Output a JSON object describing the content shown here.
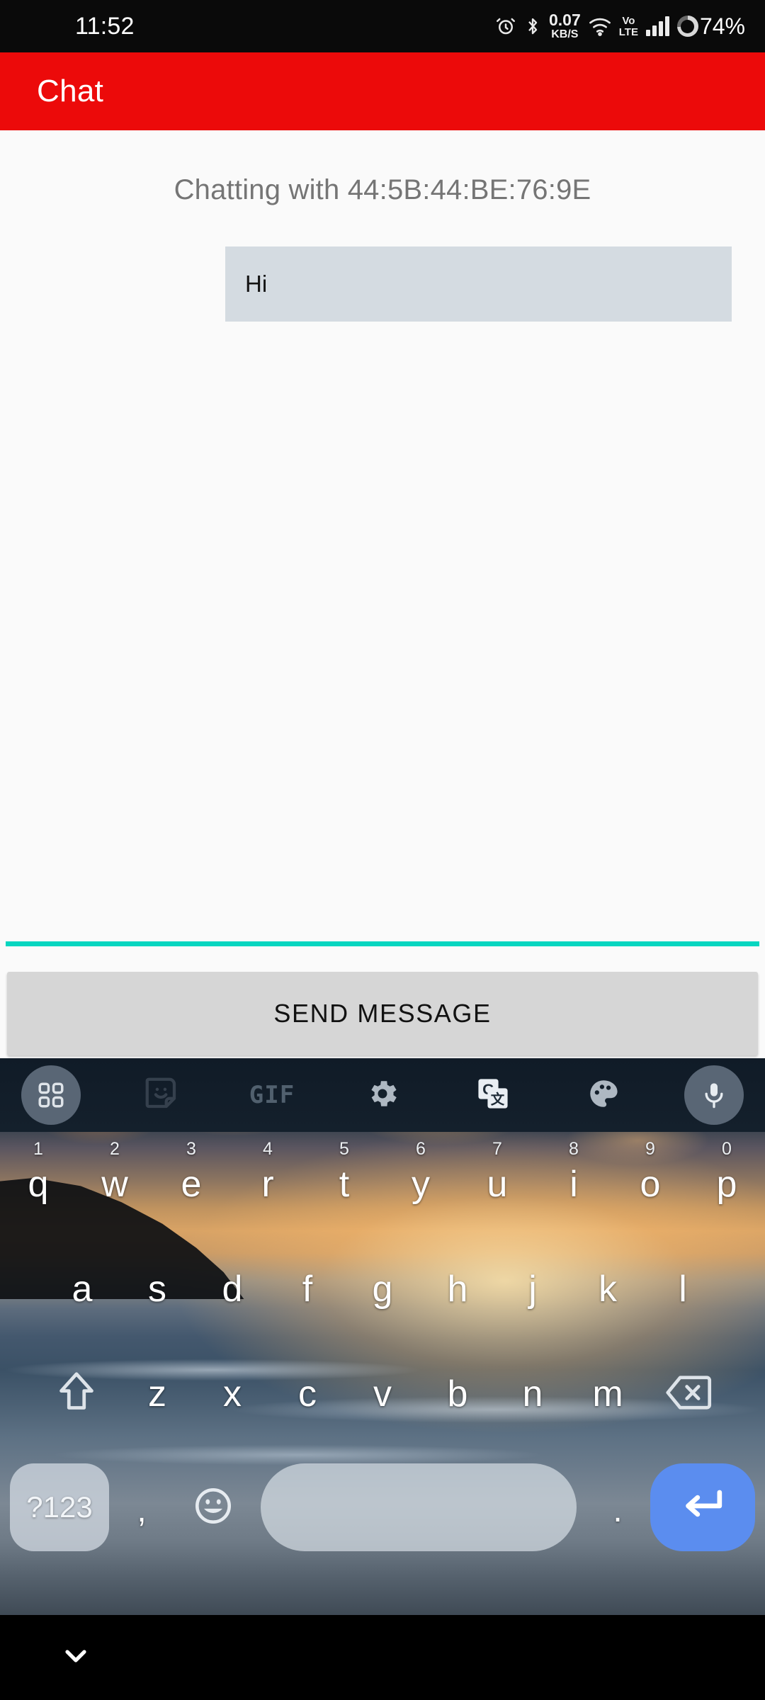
{
  "statusbar": {
    "time": "11:52",
    "net_speed_value": "0.07",
    "net_speed_unit": "KB/S",
    "volte_top": "Vo",
    "volte_bottom": "LTE",
    "battery_percent": "74%",
    "icons": [
      "alarm-icon",
      "bluetooth-icon",
      "wifi-icon",
      "volte-icon",
      "signal-icon",
      "battery-icon"
    ]
  },
  "appbar": {
    "title": "Chat",
    "color": "#EC0A0A"
  },
  "chat": {
    "header": "Chatting with 44:5B:44:BE:76:9E",
    "peer_address": "44:5B:44:BE:76:9E",
    "messages": [
      {
        "text": "Hi",
        "align": "right",
        "bubble_color": "#D4DBE1"
      }
    ],
    "divider_color": "#06D6C0"
  },
  "send": {
    "label": "SEND MESSAGE",
    "color": "#D6D6D6"
  },
  "keyboard": {
    "toolbar": [
      {
        "name": "apps-grid-icon",
        "label": ""
      },
      {
        "name": "sticker-icon",
        "label": ""
      },
      {
        "name": "gif-icon",
        "label": "GIF"
      },
      {
        "name": "settings-gear-icon",
        "label": ""
      },
      {
        "name": "translate-icon",
        "label": ""
      },
      {
        "name": "theme-palette-icon",
        "label": ""
      },
      {
        "name": "microphone-icon",
        "label": ""
      }
    ],
    "row1": [
      {
        "key": "q",
        "hint": "1"
      },
      {
        "key": "w",
        "hint": "2"
      },
      {
        "key": "e",
        "hint": "3"
      },
      {
        "key": "r",
        "hint": "4"
      },
      {
        "key": "t",
        "hint": "5"
      },
      {
        "key": "y",
        "hint": "6"
      },
      {
        "key": "u",
        "hint": "7"
      },
      {
        "key": "i",
        "hint": "8"
      },
      {
        "key": "o",
        "hint": "9"
      },
      {
        "key": "p",
        "hint": "0"
      }
    ],
    "row2": [
      "a",
      "s",
      "d",
      "f",
      "g",
      "h",
      "j",
      "k",
      "l"
    ],
    "row3": [
      "z",
      "x",
      "c",
      "v",
      "b",
      "n",
      "m"
    ],
    "row4": {
      "symbols_label": "?123",
      "comma": ",",
      "period": ".",
      "space": "",
      "emoji": "emoji-icon",
      "enter": "enter-icon",
      "enter_color": "#5B8DEF"
    },
    "shift": "shift-icon",
    "backspace": "backspace-icon"
  },
  "navbar": {
    "hide_keyboard": "chevron-down-icon"
  }
}
